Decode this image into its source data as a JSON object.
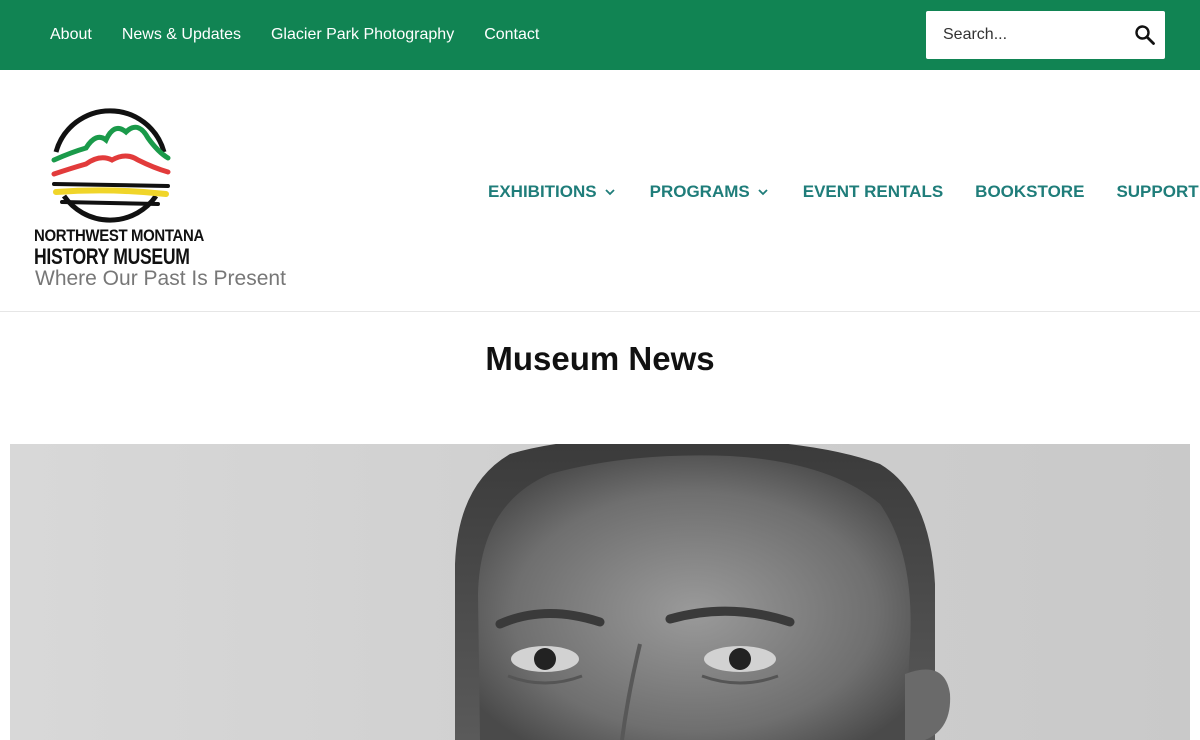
{
  "topbar": {
    "links": [
      "About",
      "News & Updates",
      "Glacier Park Photography",
      "Contact"
    ],
    "search_placeholder": "Search...",
    "search_icon": "magnifier-icon"
  },
  "brand": {
    "logo_line1": "NORTHWEST MONTANA",
    "logo_line2": "HISTORY MUSEUM",
    "tagline": "Where Our Past Is Present",
    "logo_colors": [
      "#1a9a4a",
      "#e23b3b",
      "#f0d52a",
      "#111111"
    ]
  },
  "mainnav": {
    "items": [
      {
        "label": "EXHIBITIONS",
        "icon": "chevron-down-icon"
      },
      {
        "label": "PROGRAMS",
        "icon": "chevron-down-icon"
      },
      {
        "label": "EVENT RENTALS"
      },
      {
        "label": "BOOKSTORE"
      },
      {
        "label": "SUPPORT"
      }
    ]
  },
  "page": {
    "title": "Museum News"
  },
  "colors": {
    "topbar": "#118453",
    "nav_text": "#1f7d7a",
    "tagline": "#777777"
  }
}
